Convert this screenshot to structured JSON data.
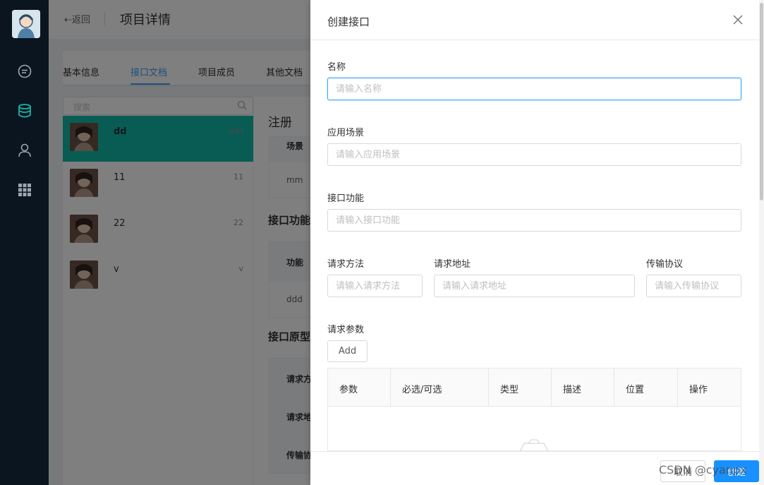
{
  "rail": {
    "icons": [
      "avatar-logo",
      "chat-icon",
      "database-icon",
      "user-icon",
      "grid-icon"
    ],
    "active_color": "#13b8a6"
  },
  "header": {
    "back": "⇠返回",
    "title": "项目详情"
  },
  "tabs": [
    "基本信息",
    "接口文档",
    "项目成员",
    "其他文档"
  ],
  "sidebar": {
    "search_placeholder": "搜索",
    "items": [
      {
        "name": "dd",
        "side": "ddd"
      },
      {
        "name": "11",
        "side": "11"
      },
      {
        "name": "22",
        "side": "22"
      },
      {
        "name": "v",
        "side": "v"
      }
    ]
  },
  "detail": {
    "title": "注册",
    "scene_header": "场景",
    "scene_value": "mm",
    "function_section": "接口功能",
    "function_header": "功能",
    "function_value": "ddd",
    "prototype_section": "接口原型",
    "proto_rows": [
      "请求方",
      "请求地",
      "传输协"
    ]
  },
  "drawer": {
    "title": "创建接口",
    "name_label": "名称",
    "name_placeholder": "请输入名称",
    "scene_label": "应用场景",
    "scene_placeholder": "请输入应用场景",
    "function_label": "接口功能",
    "function_placeholder": "请输入接口功能",
    "method_label": "请求方法",
    "method_placeholder": "请输入请求方法",
    "url_label": "请求地址",
    "url_placeholder": "请输入请求地址",
    "protocol_label": "传输协议",
    "protocol_placeholder": "请输入传输协议",
    "params_label": "请求参数",
    "add_button": "Add",
    "columns": [
      "参数",
      "必选/可选",
      "类型",
      "描述",
      "位置",
      "操作"
    ],
    "cancel_button": "取消",
    "confirm_button": "创建",
    "watermark": "CSDN @cyanpx"
  }
}
